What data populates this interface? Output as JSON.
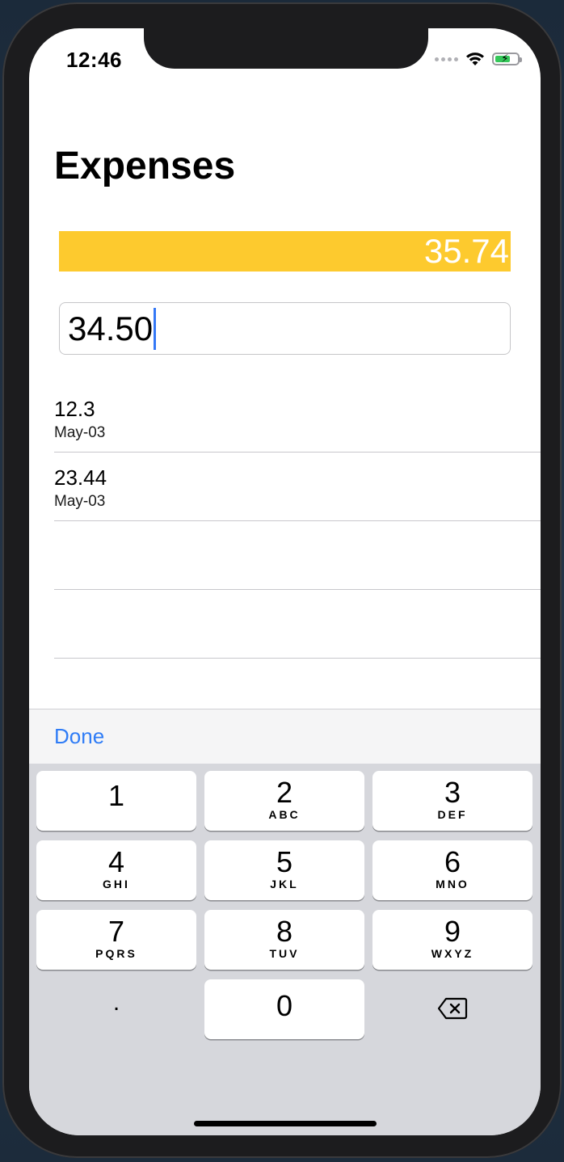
{
  "status": {
    "time": "12:46"
  },
  "page": {
    "title": "Expenses"
  },
  "total": {
    "value": "35.74",
    "bar_color": "#fdca2e"
  },
  "input": {
    "value": "34.50"
  },
  "expenses": [
    {
      "amount": "12.3",
      "date": "May-03"
    },
    {
      "amount": "23.44",
      "date": "May-03"
    },
    {
      "amount": "",
      "date": ""
    },
    {
      "amount": "",
      "date": ""
    }
  ],
  "toolbar": {
    "done_label": "Done"
  },
  "keypad": {
    "keys": [
      {
        "num": "1",
        "letters": ""
      },
      {
        "num": "2",
        "letters": "ABC"
      },
      {
        "num": "3",
        "letters": "DEF"
      },
      {
        "num": "4",
        "letters": "GHI"
      },
      {
        "num": "5",
        "letters": "JKL"
      },
      {
        "num": "6",
        "letters": "MNO"
      },
      {
        "num": "7",
        "letters": "PQRS"
      },
      {
        "num": "8",
        "letters": "TUV"
      },
      {
        "num": "9",
        "letters": "WXYZ"
      },
      {
        "num": ".",
        "letters": ""
      },
      {
        "num": "0",
        "letters": ""
      },
      {
        "num": "",
        "letters": "",
        "icon": "backspace-icon"
      }
    ]
  },
  "colors": {
    "accent": "#2f7cf6",
    "caret": "#3478f6",
    "battery": "#34c759"
  }
}
